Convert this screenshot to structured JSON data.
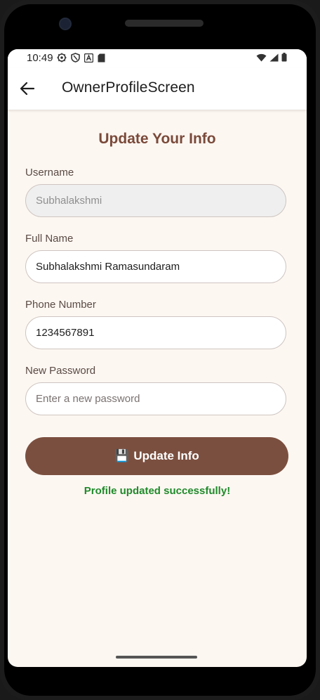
{
  "status_bar": {
    "time": "10:49",
    "left_icons": [
      "settings-gear-icon",
      "shield-icon",
      "a-letter-icon",
      "sim-card-icon"
    ],
    "right_icons": [
      "wifi-icon",
      "signal-icon",
      "battery-icon"
    ]
  },
  "app_bar": {
    "back_icon": "arrow-left-icon",
    "title": "OwnerProfileScreen"
  },
  "form": {
    "title": "Update Your Info",
    "username_label": "Username",
    "username_value": "Subhalakshmi",
    "fullname_label": "Full Name",
    "fullname_value": "Subhalakshmi Ramasundaram",
    "phone_label": "Phone Number",
    "phone_value": "1234567891",
    "password_label": "New Password",
    "password_placeholder": "Enter a new password",
    "submit_icon": "💾",
    "submit_label": "Update Info",
    "success_message": "Profile updated successfully!"
  },
  "colors": {
    "accent": "#7b4f3f",
    "title": "#7a4a3a",
    "success": "#1f8a2a",
    "screen_bg": "#fdf7f2"
  }
}
